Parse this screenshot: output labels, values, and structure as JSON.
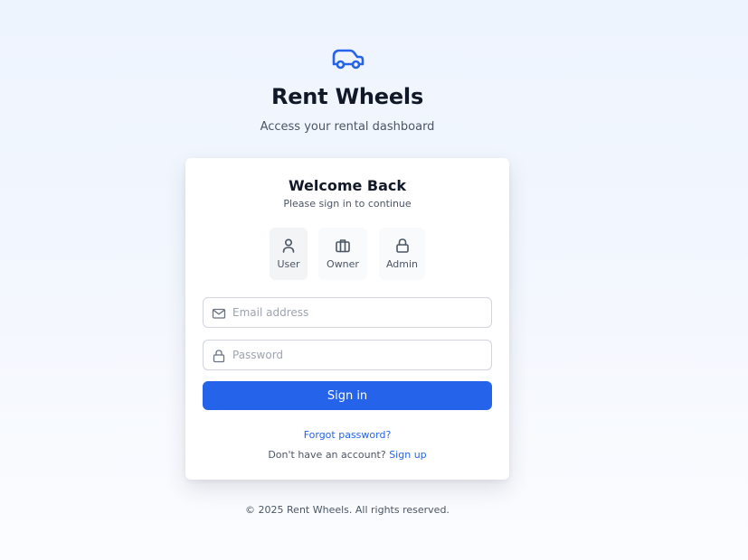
{
  "brand": {
    "icon": "car-icon",
    "title": "Rent Wheels",
    "subtitle": "Access your rental dashboard",
    "accent_color": "#2563eb"
  },
  "card": {
    "title": "Welcome Back",
    "subtitle": "Please sign in to continue"
  },
  "roles": [
    {
      "label": "User",
      "icon": "user-icon",
      "selected": true
    },
    {
      "label": "Owner",
      "icon": "briefcase-icon",
      "selected": false
    },
    {
      "label": "Admin",
      "icon": "lock-icon",
      "selected": false
    }
  ],
  "form": {
    "email": {
      "placeholder": "Email address",
      "value": "",
      "icon": "mail-icon"
    },
    "password": {
      "placeholder": "Password",
      "value": "",
      "icon": "lock-icon"
    },
    "submit_label": "Sign in"
  },
  "links": {
    "forgot_password": "Forgot password?",
    "signup_prompt": "Don't have an account?",
    "signup_label": "Sign up"
  },
  "footer": {
    "text": "© 2025 Rent Wheels. All rights reserved."
  }
}
